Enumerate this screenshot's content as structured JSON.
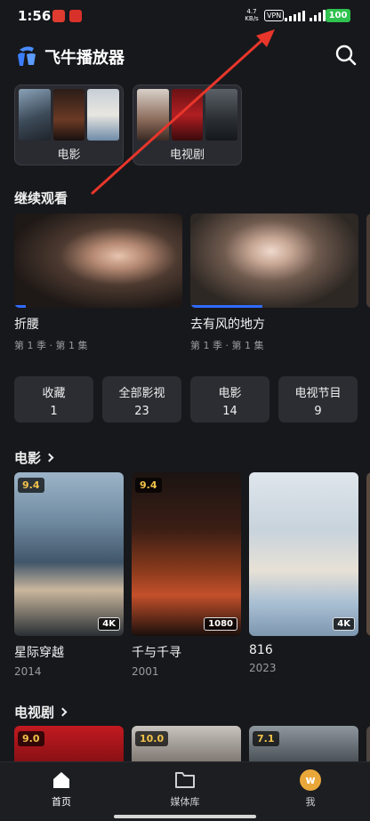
{
  "status_bar": {
    "time": "1:56",
    "net_speed_top": "4.7",
    "net_speed_bottom": "KB/s",
    "vpn": "VPN",
    "battery": "100"
  },
  "header": {
    "title": "飞牛播放器"
  },
  "libraries": [
    {
      "name": "电影"
    },
    {
      "name": "电视剧"
    }
  ],
  "continue_watching": {
    "title": "继续观看",
    "items": [
      {
        "title": "折腰",
        "subtitle": "第 1 季 · 第 1 集",
        "progress": 0.07
      },
      {
        "title": "去有风的地方",
        "subtitle": "第 1 季 · 第 1 集",
        "progress": 0.43
      }
    ]
  },
  "stats": [
    {
      "label": "收藏",
      "count": "1"
    },
    {
      "label": "全部影视",
      "count": "23"
    },
    {
      "label": "电影",
      "count": "14"
    },
    {
      "label": "电视节目",
      "count": "9"
    }
  ],
  "movies": {
    "title": "电影",
    "items": [
      {
        "title": "星际穿越",
        "year": "2014",
        "rating": "9.4",
        "badge": "4K"
      },
      {
        "title": "千与千寻",
        "year": "2001",
        "rating": "9.4",
        "badge": "1080"
      },
      {
        "title": "816",
        "year": "2023",
        "rating": "",
        "badge": "4K"
      }
    ]
  },
  "tv_shows": {
    "title": "电视剧",
    "items": [
      {
        "rating": "9.0"
      },
      {
        "rating": "10.0"
      },
      {
        "rating": "7.1"
      }
    ]
  },
  "tabbar": {
    "home": "首页",
    "library": "媒体库",
    "me": "我",
    "avatar_letter": "w"
  },
  "colors": {
    "background": "#17181c",
    "accent": "#2f6bff",
    "rating": "#f1c24a",
    "battery": "#2fc24e",
    "annotation_arrow": "#e8362b"
  }
}
